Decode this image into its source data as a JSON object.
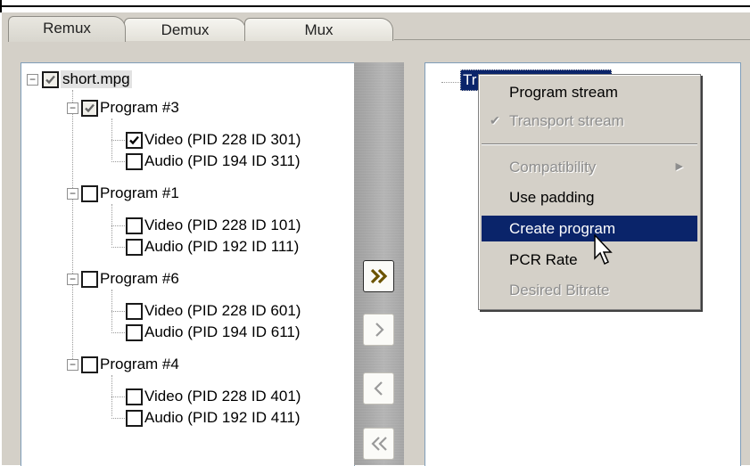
{
  "tabs": [
    {
      "label": "Remux",
      "active": true
    },
    {
      "label": "Demux",
      "active": false
    },
    {
      "label": "Mux",
      "active": false
    }
  ],
  "tree": {
    "root": {
      "label": "short.mpg",
      "checked": true
    },
    "programs": [
      {
        "label": "Program #3",
        "checked": true,
        "streams": [
          {
            "label": "Video (PID 228 ID 301)",
            "checked": true
          },
          {
            "label": "Audio (PID 194 ID 311)",
            "checked": false
          }
        ]
      },
      {
        "label": "Program #1",
        "checked": false,
        "streams": [
          {
            "label": "Video (PID 228 ID 101)",
            "checked": false
          },
          {
            "label": "Audio (PID 192 ID 111)",
            "checked": false
          }
        ]
      },
      {
        "label": "Program #6",
        "checked": false,
        "streams": [
          {
            "label": "Video (PID 228 ID 601)",
            "checked": false
          },
          {
            "label": "Audio (PID 194 ID 611)",
            "checked": false
          }
        ]
      },
      {
        "label": "Program #4",
        "checked": false,
        "streams": [
          {
            "label": "Video (PID 228 ID 401)",
            "checked": false
          },
          {
            "label": "Audio (PID 192 ID 411)",
            "checked": false
          }
        ]
      }
    ]
  },
  "transfer_buttons": [
    {
      "icon": "double-chevron-right-icon",
      "enabled": true
    },
    {
      "icon": "chevron-right-icon",
      "enabled": false
    },
    {
      "icon": "chevron-left-icon",
      "enabled": false
    },
    {
      "icon": "double-chevron-left-icon",
      "enabled": false
    }
  ],
  "output_tree": {
    "selected_label": "Tr"
  },
  "context_menu": {
    "items": [
      {
        "label": "Program stream",
        "state": "normal"
      },
      {
        "label": "Transport stream",
        "state": "disabled",
        "checked": true
      },
      {
        "label": "Compatibility",
        "state": "disabled",
        "submenu": true
      },
      {
        "label": "Use padding",
        "state": "normal"
      },
      {
        "label": "Create program",
        "state": "hover"
      },
      {
        "label": "PCR Rate",
        "state": "normal"
      },
      {
        "label": "Desired Bitrate",
        "state": "disabled"
      }
    ],
    "check_glyph": "✔",
    "submenu_glyph": "▶"
  },
  "colors": {
    "face": "#d4d0c8",
    "highlight": "#0a246a",
    "disabled_text": "#8d8d8d",
    "tree_border": "#7f9db9"
  }
}
